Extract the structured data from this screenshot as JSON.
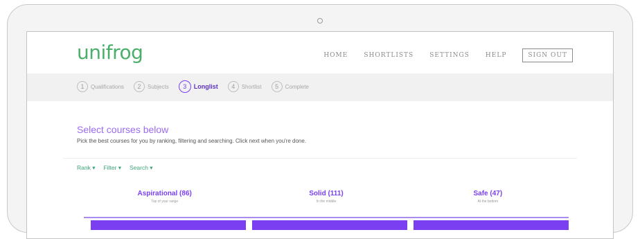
{
  "app": {
    "logo": "unifrog"
  },
  "nav": {
    "home": "HOME",
    "shortlists": "SHORTLISTS",
    "settings": "SETTINGS",
    "help": "HELP",
    "signout": "SIGN OUT"
  },
  "steps": [
    {
      "num": "1",
      "label": "Qualifications"
    },
    {
      "num": "2",
      "label": "Subjects"
    },
    {
      "num": "3",
      "label": "Longlist"
    },
    {
      "num": "4",
      "label": "Shortlist"
    },
    {
      "num": "5",
      "label": "Complete"
    }
  ],
  "page": {
    "heading": "Select courses below",
    "instructions": "Pick the best courses for you by ranking, filtering and searching. Click next when you're done."
  },
  "filters": {
    "rank": "Rank ▾",
    "filter": "Filter ▾",
    "search": "Search ▾"
  },
  "columns": [
    {
      "title": "Aspirational (86)",
      "subtitle": "Top of your range"
    },
    {
      "title": "Solid (111)",
      "subtitle": "In the middle"
    },
    {
      "title": "Safe (47)",
      "subtitle": "At the bottom"
    }
  ],
  "colors": {
    "brand_green": "#4cae6b",
    "accent_purple": "#7b3ff2"
  }
}
